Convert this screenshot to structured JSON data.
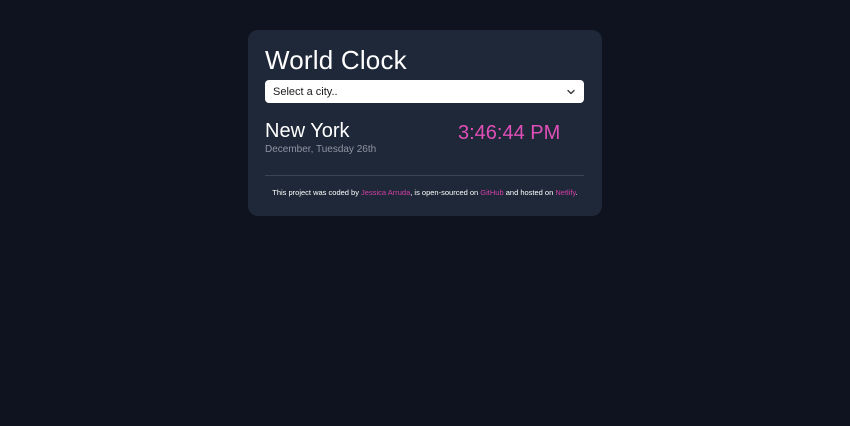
{
  "app": {
    "title": "World Clock"
  },
  "city_select": {
    "selected": "Select a city.."
  },
  "city": {
    "name": "New York",
    "date": "December, Tuesday 26th",
    "time": "3:46:44 PM"
  },
  "footer": {
    "text_1": "This project was coded by ",
    "author": "Jessica Arruda",
    "text_2": ", is open-sourced on ",
    "github": "GitHub",
    "text_3": " and hosted on ",
    "netlify": "Netlify",
    "text_4": "."
  },
  "colors": {
    "background": "#0f1320",
    "card": "#1f2838",
    "accent": "#e04fb8"
  },
  "icons": {
    "select_arrow": "chevron-down-icon"
  }
}
